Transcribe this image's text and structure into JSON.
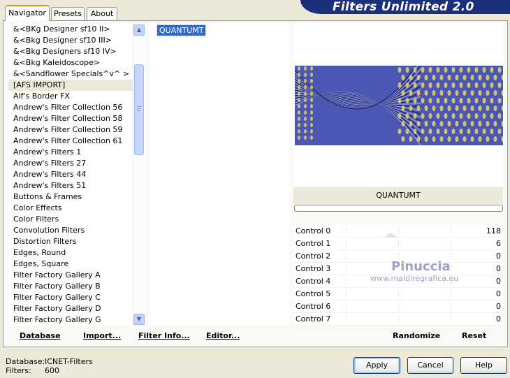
{
  "app": {
    "title": "Filters Unlimited 2.0"
  },
  "tabs": [
    {
      "label": "Navigator",
      "active": true
    },
    {
      "label": "Presets",
      "active": false
    },
    {
      "label": "About",
      "active": false
    }
  ],
  "categories": [
    "&<BKg Designer sf10 II>",
    "&<Bkg Designer sf10 III>",
    "&<Bkg Designers sf10 IV>",
    "&<Bkg Kaleidoscope>",
    "&<Sandflower Specials^v^ >",
    "[AFS IMPORT]",
    "Alf's Border FX",
    "Andrew's Filter Collection 56",
    "Andrew's Filter Collection 58",
    "Andrew's Filter Collection 59",
    "Andrew's Filter Collection 61",
    "Andrew's Filters 1",
    "Andrew's Filters 27",
    "Andrew's Filters 44",
    "Andrew's Filters 51",
    "Buttons & Frames",
    "Color Effects",
    "Color Filters",
    "Convolution Filters",
    "Distortion Filters",
    "Edges, Round",
    "Edges, Square",
    "Filter Factory Gallery A",
    "Filter Factory Gallery B",
    "Filter Factory Gallery C",
    "Filter Factory Gallery D",
    "Filter Factory Gallery G"
  ],
  "selected_category_index": 5,
  "filters": [
    "QUANTUMT"
  ],
  "panel_buttons": {
    "database": "Database",
    "import": "Import...",
    "filter_info": "Filter Info...",
    "editor": "Editor..."
  },
  "preview": {
    "filter_name": "QUANTUMT",
    "base_color": "#4b57b3",
    "accent_color": "#e8d56a"
  },
  "controls": [
    {
      "label": "Control 0",
      "value": "118"
    },
    {
      "label": "Control 1",
      "value": "6"
    },
    {
      "label": "Control 2",
      "value": "0"
    },
    {
      "label": "Control 3",
      "value": "0"
    },
    {
      "label": "Control 4",
      "value": "0"
    },
    {
      "label": "Control 5",
      "value": "0"
    },
    {
      "label": "Control 6",
      "value": "0"
    },
    {
      "label": "Control 7",
      "value": "0"
    }
  ],
  "watermark": {
    "name": "Pinuccia",
    "url": "www.maidiregrafica.eu"
  },
  "randomize_label": "Randomize",
  "reset_label": "Reset",
  "status": {
    "database_label": "Database:",
    "database_value": "ICNET-Filters",
    "filters_label": "Filters:",
    "filters_value": "600"
  },
  "dialog_buttons": {
    "apply": "Apply",
    "cancel": "Cancel",
    "help": "Help"
  }
}
